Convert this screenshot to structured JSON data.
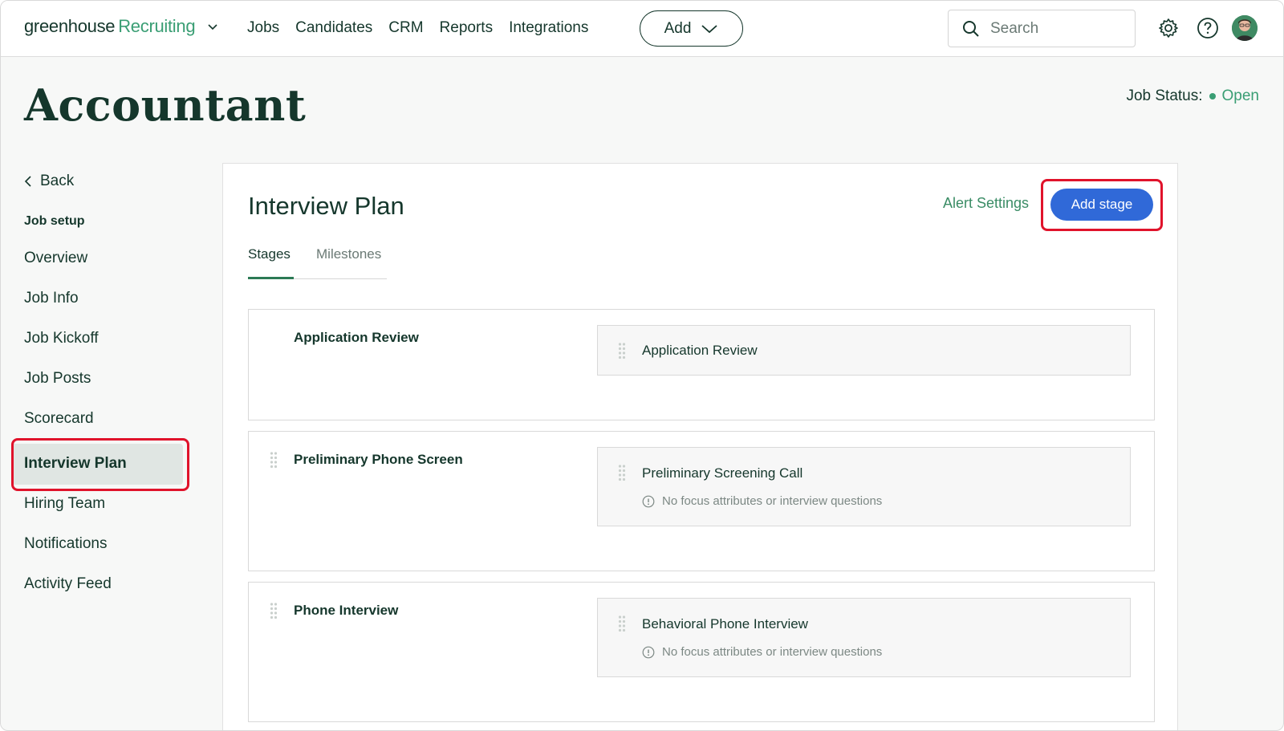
{
  "nav": {
    "brand_primary": "greenhouse",
    "brand_secondary": "Recruiting",
    "links": [
      "Jobs",
      "Candidates",
      "CRM",
      "Reports",
      "Integrations"
    ],
    "add_label": "Add",
    "search_placeholder": "Search"
  },
  "header": {
    "title": "Accountant",
    "job_status_label": "Job Status:",
    "job_status_value": "Open"
  },
  "sidebar": {
    "back_label": "Back",
    "section_heading": "Job setup",
    "items": [
      "Overview",
      "Job Info",
      "Job Kickoff",
      "Job Posts",
      "Scorecard",
      "Interview Plan",
      "Hiring Team",
      "Notifications",
      "Activity Feed"
    ],
    "active_item": "Interview Plan"
  },
  "main": {
    "title": "Interview Plan",
    "alert_settings_label": "Alert Settings",
    "add_stage_label": "Add stage",
    "tabs": [
      "Stages",
      "Milestones"
    ],
    "active_tab": "Stages",
    "stages": [
      {
        "name": "Application Review",
        "interviews": [
          {
            "name": "Application Review",
            "note": ""
          }
        ]
      },
      {
        "name": "Preliminary Phone Screen",
        "interviews": [
          {
            "name": "Preliminary Screening Call",
            "note": "No focus attributes or interview questions"
          }
        ]
      },
      {
        "name": "Phone Interview",
        "interviews": [
          {
            "name": "Behavioral Phone Interview",
            "note": "No focus attributes or interview questions"
          }
        ]
      }
    ]
  },
  "colors": {
    "brand_green": "#3a9e74",
    "primary_blue": "#3069d8",
    "highlight_red": "#e0132b",
    "text_dark": "#15372c"
  }
}
